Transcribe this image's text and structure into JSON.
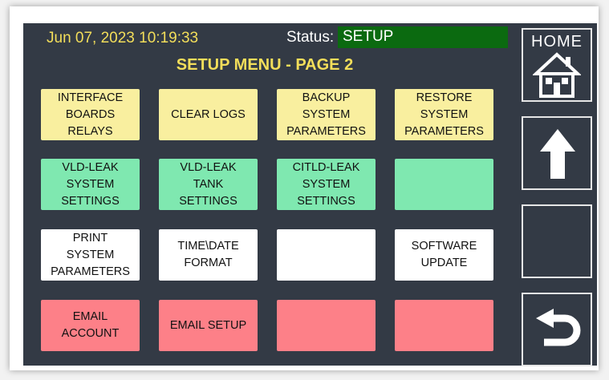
{
  "header": {
    "datetime": "Jun 07, 2023 10:19:33",
    "status_label": "Status:",
    "status_value": "SETUP",
    "title": "SETUP MENU - PAGE 2"
  },
  "tiles": [
    {
      "label": "INTERFACE\nBOARDS\nRELAYS",
      "color": "yellow"
    },
    {
      "label": "CLEAR LOGS",
      "color": "yellow"
    },
    {
      "label": "BACKUP\nSYSTEM\nPARAMETERS",
      "color": "yellow"
    },
    {
      "label": "RESTORE\nSYSTEM\nPARAMETERS",
      "color": "yellow"
    },
    {
      "label": "VLD-LEAK\nSYSTEM\nSETTINGS",
      "color": "green"
    },
    {
      "label": "VLD-LEAK\nTANK\nSETTINGS",
      "color": "green"
    },
    {
      "label": "CITLD-LEAK\nSYSTEM\nSETTINGS",
      "color": "green"
    },
    {
      "label": "",
      "color": "green"
    },
    {
      "label": "PRINT\nSYSTEM\nPARAMETERS",
      "color": "white"
    },
    {
      "label": "TIME\\DATE\nFORMAT",
      "color": "white"
    },
    {
      "label": "",
      "color": "white"
    },
    {
      "label": "SOFTWARE\nUPDATE",
      "color": "white"
    },
    {
      "label": "EMAIL\nACCOUNT",
      "color": "red"
    },
    {
      "label": "EMAIL SETUP",
      "color": "red"
    },
    {
      "label": "",
      "color": "red"
    },
    {
      "label": "",
      "color": "red"
    }
  ],
  "side": {
    "home_label": "HOME",
    "home_icon": "house-icon",
    "up_icon": "arrow-up-icon",
    "back_icon": "return-arrow-icon"
  },
  "colors": {
    "background": "#333a45",
    "accent_yellow": "#f3de5a",
    "status_green": "#0b6a10",
    "tile_yellow": "#f9ef9f",
    "tile_green": "#7fe8b0",
    "tile_white": "#ffffff",
    "tile_red": "#fd8088"
  }
}
